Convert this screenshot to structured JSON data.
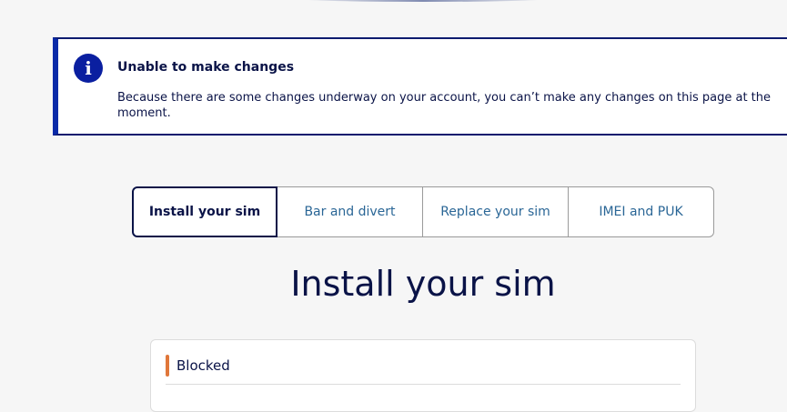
{
  "alert": {
    "icon": "info-icon",
    "icon_glyph": "i",
    "title": "Unable to make changes",
    "body": "Because there are some changes underway on your account, you can’t make any changes on this page at the moment."
  },
  "tabs": [
    {
      "label": "Install your sim",
      "active": true
    },
    {
      "label": "Bar and divert",
      "active": false
    },
    {
      "label": "Replace your sim",
      "active": false
    },
    {
      "label": "IMEI and PUK",
      "active": false
    }
  ],
  "section": {
    "title": "Install your sim"
  },
  "status": {
    "label": "Blocked",
    "color": "#e0773a"
  },
  "colors": {
    "brand_navy": "#0a1347",
    "accent_blue": "#0a2aa8",
    "link_blue": "#2a6696"
  }
}
